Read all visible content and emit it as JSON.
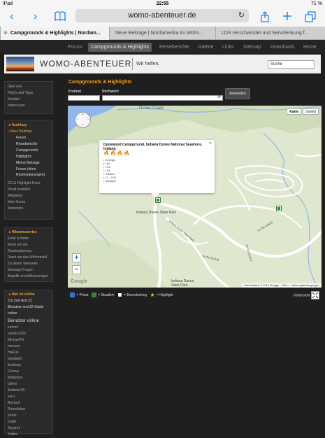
{
  "statusbar": {
    "device": "iPad",
    "time": "22:55",
    "battery": "71 %"
  },
  "browser": {
    "url": "womo-abenteuer.de",
    "tabs": [
      "Campgrounds & Highlights | Nordam...",
      "Neue Beiträge | Nordamerika im Wohn...",
      "LDS verschwindet und Servolenkung f..."
    ]
  },
  "nav": {
    "items": [
      "Forum",
      "Campgrounds & Highlights",
      "Reiseberichte",
      "Galerie",
      "Links",
      "Sitemap",
      "Downloads",
      "Home"
    ]
  },
  "header": {
    "logo": "WOMO-ABENTEUER",
    "tagline": "Wir helfen.",
    "search_value": "Suche"
  },
  "sidebar": {
    "about": [
      "Über uns",
      "FAQ's und Tipps",
      "Kontakt",
      "Impressum"
    ],
    "fischluzy_title": "fischluzy",
    "fischluzy_main": "Neue Beiträge",
    "fischluzy_sub": [
      "Forum",
      "Reiseberichte",
      "Campgrounds",
      "Highlights",
      "Meine Beiträge",
      "Forum (ohne",
      "Routenplanungen)"
    ],
    "fischluzy_more": [
      "CG & Highlight-Karte",
      "Inhalt erstellen",
      "Mitglieder",
      "Mein Konto",
      "Abmelden"
    ],
    "wissen_title": "Wissenswertes",
    "wissen_items": [
      "Erste Schritte",
      "Rund um die",
      "Routenplanung",
      "Rund um das Wohnmobil",
      "Zu dieser Webseite",
      "Sonstige Fragen",
      "Begriffe und Abkürzungen"
    ],
    "online_title": "Wer ist online",
    "online_text_1": "Zur Zeit sind 22",
    "online_text_2": "Benutzer und 22 Gäste",
    "online_text_3": "online.",
    "online_heading": "Benutzer online",
    "online_users": [
      "voenni",
      "sandra1991",
      "MichaelTE",
      "manuze",
      "HaRue",
      "Gejobbt2",
      "fischluzy",
      "Groovy",
      "Maltemez",
      "cBerti",
      "Andrea100",
      "suru",
      "Richard",
      "Reisefieber",
      "JoAnl",
      "trakki",
      "Jürgen1",
      "Jindra"
    ]
  },
  "content": {
    "title": "Campgrounds & Highlights",
    "freitext_label": "Freitext",
    "stichwort_label": "Stichwort:",
    "apply_label": "Anwenden"
  },
  "map": {
    "type_map": "Karte",
    "type_sat": "Satellit",
    "creek_label": "Dunes Creek",
    "park_label": "Indiana Dunes State Park",
    "road_labels": [
      "Indiana Dunes State Park",
      "Co Rd 1100 E",
      "Co Rd 1100 E",
      "Co Rd 1100 E"
    ],
    "bottom_label": "Indiana Dunes",
    "bottom_label2": "State Park",
    "attribution": "Kartendaten © 2014 Google",
    "scale": "100 m",
    "terms": "Nutzungsbedingungen",
    "logo": "Google",
    "popup": {
      "title": "Dunewood Campground, Indiana Dunes National Seashore, Indiana",
      "flames": "🔥🔥🔥🔥",
      "details": [
        "Chicago",
        "I-80",
        "I-94",
        "I-94",
        "Indiana",
        "11 - 20 $",
        "Staatlich"
      ]
    }
  },
  "legend": {
    "privat": "= Privat",
    "staatlich": "= Staatlich",
    "boondocking": "= Boondocking",
    "highlight": "= Highlight",
    "fullscreen": "Vollansicht"
  },
  "colors": {
    "accent": "#f0a020",
    "map_bg": "#dfe8cf",
    "water": "#8fb7ea",
    "road": "#ffffff",
    "ios_blue": "#1e7cf2"
  }
}
